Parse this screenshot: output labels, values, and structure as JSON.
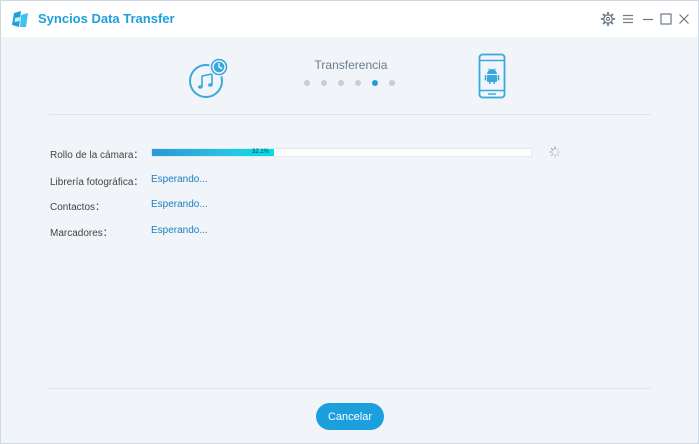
{
  "app": {
    "title": "Syncios Data Transfer",
    "accent_color": "#1ea0dc",
    "logo_icon": "syncios-logo-icon",
    "window_controls": [
      "gear-icon",
      "menu-icon",
      "minimize-icon",
      "maximize-icon",
      "close-icon"
    ]
  },
  "steps": {
    "label": "Transferencia",
    "source_icon": "itunes-backup-icon",
    "target_icon": "android-phone-icon",
    "dot_count": 6,
    "active_dot_index": 4
  },
  "transfer": {
    "rows": [
      {
        "label": "Rollo de la cámara：",
        "progress_fraction": 0.321,
        "progress_text": "32.1%",
        "status": ""
      },
      {
        "label": "Librería fotográfica：",
        "status": "Esperando..."
      },
      {
        "label": "Contactos：",
        "status": "Esperando..."
      },
      {
        "label": "Marcadores：",
        "status": "Esperando..."
      }
    ]
  },
  "footer": {
    "cancel_label": "Cancelar"
  }
}
